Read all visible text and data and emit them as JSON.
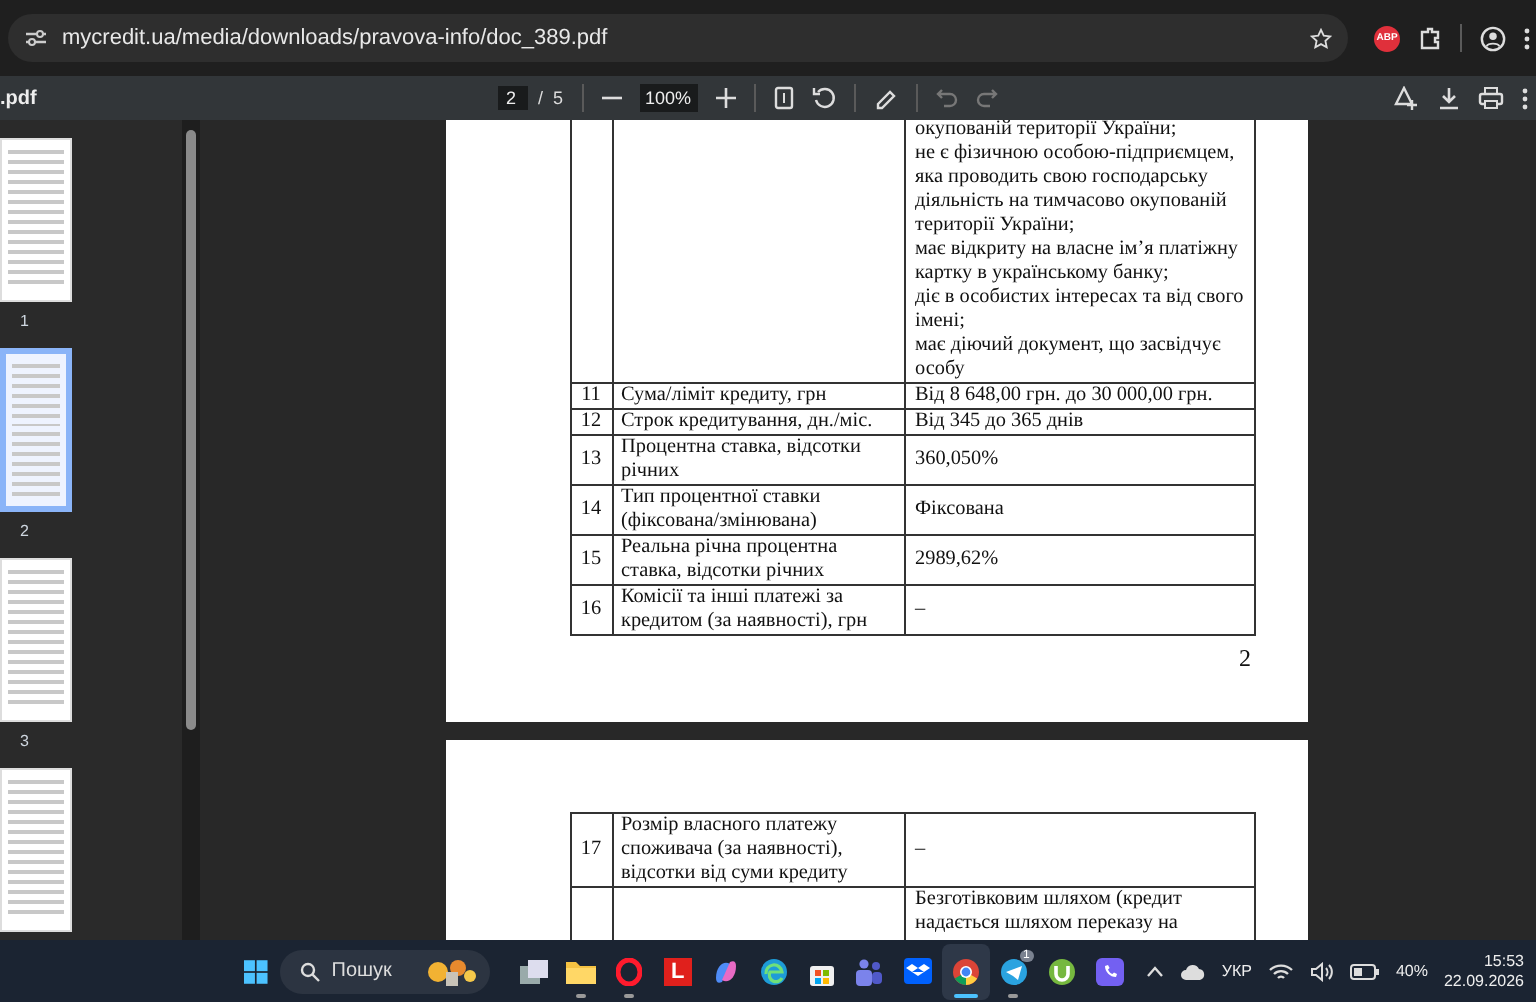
{
  "browser": {
    "url": "mycredit.ua/media/downloads/pravova-info/doc_389.pdf",
    "extension_label": "ABP"
  },
  "pdf_toolbar": {
    "file_name": ".pdf",
    "page_input": "2",
    "page_separator": "/",
    "page_total": "5",
    "zoom": "100%"
  },
  "thumbnails": [
    {
      "label": "1",
      "selected": false
    },
    {
      "label": "2",
      "selected": true
    },
    {
      "label": "3",
      "selected": false
    },
    {
      "selected": false
    }
  ],
  "pages": [
    {
      "page_number": "2",
      "rows": [
        {
          "value_lines": [
            "окупованій території України;",
            "не є фізичною особою-підприємцем, яка проводить свою господарську діяльність на тимчасово окупованій території України;",
            "має відкриту на власне ім’я платіжну картку в українському банку;",
            "діє в особистих інтересах та від свого імені;",
            "має діючий документ, що засвідчує особу"
          ]
        },
        {
          "number": "11",
          "item": "Сума/ліміт кредиту, грн",
          "value_lines": [
            "Від 8 648,00 грн. до 30 000,00 грн."
          ]
        },
        {
          "number": "12",
          "item": "Строк кредитування, дн./міс.",
          "value_lines": [
            "Від 345 до 365 днів"
          ]
        },
        {
          "number": "13",
          "item": "Процентна ставка, відсотки річних",
          "value_lines": [
            "360,050%"
          ]
        },
        {
          "number": "14",
          "item": "Тип процентної ставки (фіксована/змінювана)",
          "value_lines": [
            "Фіксована"
          ]
        },
        {
          "number": "15",
          "item": "Реальна річна процентна ставка, відсотки річних",
          "value_lines": [
            "2989,62%"
          ]
        },
        {
          "number": "16",
          "item": "Комісії та інші платежі за кредитом (за наявності), грн",
          "value_lines": [
            "–"
          ]
        }
      ]
    },
    {
      "rows": [
        {
          "number": "17",
          "item": "Розмір власного платежу споживача (за наявності), відсотки від суми кредиту",
          "value_lines": [
            "–"
          ]
        },
        {
          "value_lines": [
            "Безготівковим шляхом (кредит надається шляхом переказу на"
          ]
        }
      ]
    }
  ],
  "taskbar": {
    "search_placeholder": "Пошук",
    "apps": [
      {
        "kind": "task-view",
        "running": false,
        "selected": false
      },
      {
        "kind": "folder",
        "running": true,
        "selected": false
      },
      {
        "kind": "opera",
        "running": true,
        "selected": false
      },
      {
        "kind": "letter",
        "label": "L",
        "running": false,
        "selected": false
      },
      {
        "kind": "copilot",
        "running": false,
        "selected": false
      },
      {
        "kind": "edge",
        "running": false,
        "selected": false
      },
      {
        "kind": "store",
        "running": false,
        "selected": false
      },
      {
        "kind": "teams",
        "running": false,
        "selected": false
      },
      {
        "kind": "dropbox",
        "running": false,
        "selected": false
      },
      {
        "kind": "chrome",
        "running": true,
        "selected": true
      },
      {
        "kind": "telegram",
        "running": true,
        "selected": false,
        "badge": "1"
      },
      {
        "kind": "utorrent",
        "running": false,
        "selected": false
      },
      {
        "kind": "viber",
        "running": false,
        "selected": false
      }
    ],
    "tray": {
      "language": "УКР",
      "battery": "40%",
      "time": "15:53",
      "date": "22.09.2026"
    }
  }
}
